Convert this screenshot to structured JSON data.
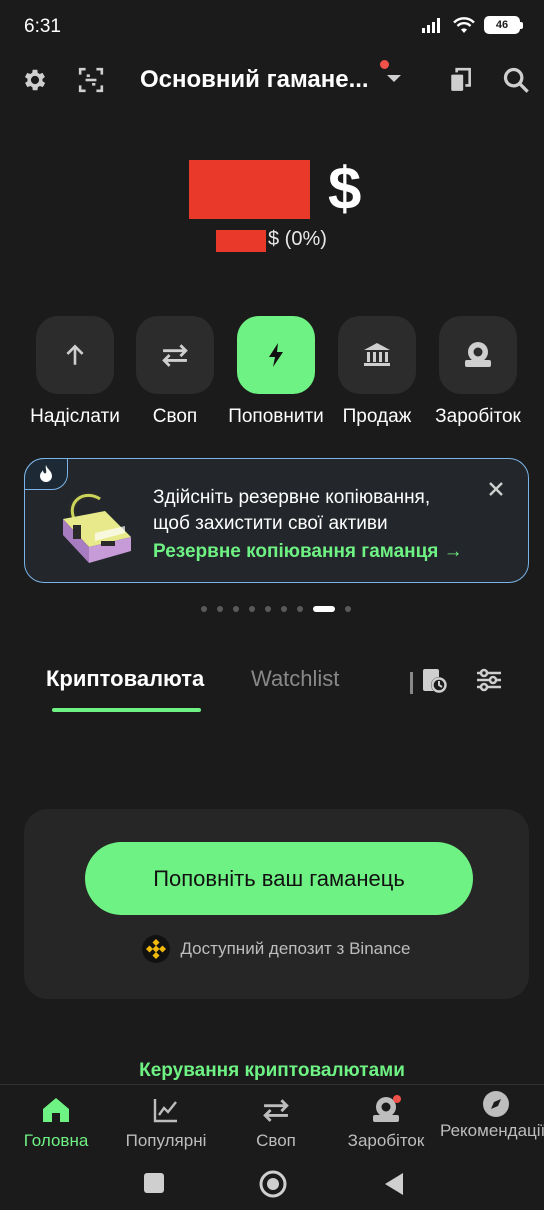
{
  "status_bar": {
    "time": "6:31",
    "battery": "46"
  },
  "top_bar": {
    "wallet_name": "Основний гамане..."
  },
  "balance": {
    "currency_symbol": "$",
    "change_text": "$ (0%)"
  },
  "actions": [
    {
      "label": "Надіслати",
      "icon": "arrow-up-icon"
    },
    {
      "label": "Своп",
      "icon": "swap-icon"
    },
    {
      "label": "Поповнити",
      "icon": "lightning-icon"
    },
    {
      "label": "Продаж",
      "icon": "bank-icon"
    },
    {
      "label": "Заробіток",
      "icon": "earn-icon"
    }
  ],
  "banner": {
    "line1": "Здійсніть резервне копіювання,",
    "line2": "щоб захистити свої активи",
    "link": "Резервне копіювання гаманця →"
  },
  "carousel": {
    "total": 9,
    "active_index": 7
  },
  "tabs": {
    "crypto": "Криптовалюта",
    "watchlist": "Watchlist"
  },
  "deposit": {
    "button": "Поповніть ваш гаманець",
    "binance": "Доступний депозит з Binance"
  },
  "manage_link": "Керування криптовалютами",
  "bottom_nav": [
    {
      "label": "Головна",
      "icon": "home-icon",
      "active": true
    },
    {
      "label": "Популярні",
      "icon": "trending-icon",
      "active": false
    },
    {
      "label": "Своп",
      "icon": "swap-icon",
      "active": false
    },
    {
      "label": "Заробіток",
      "icon": "earn-icon",
      "active": false
    },
    {
      "label": "Рекомендації",
      "icon": "compass-icon",
      "active": false
    }
  ],
  "colors": {
    "accent": "#6ff284",
    "background": "#1b1b1b",
    "redaction": "#e8392a",
    "notification": "#f0524a"
  }
}
